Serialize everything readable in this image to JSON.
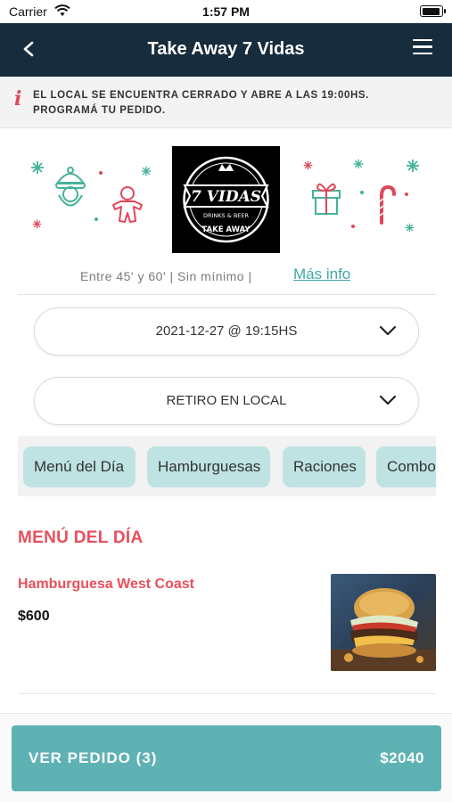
{
  "status_bar": {
    "carrier": "Carrier",
    "time": "1:57 PM"
  },
  "header": {
    "title": "Take Away 7 Vidas",
    "back_icon": "chevron-left-icon",
    "menu_icon": "hamburger-menu-icon"
  },
  "notice": {
    "icon": "info-icon",
    "icon_glyph": "i",
    "text": "EL LOCAL SE ENCUENTRA CERRADO Y ABRE A LAS 19:00HS. PROGRAMÁ TU PEDIDO."
  },
  "logo": {
    "brand": "7 VIDAS",
    "tagline": "DRINKS & BEER",
    "subtitle": "TAKE AWAY"
  },
  "info": {
    "text": "Entre 45' y 60' | Sin mínimo |",
    "link": "Más info"
  },
  "schedule_select": {
    "value": "2021-12-27 @ 19:15HS"
  },
  "delivery_select": {
    "value": "RETIRO EN LOCAL"
  },
  "categories": [
    {
      "label": "Menú del Día"
    },
    {
      "label": "Hamburguesas"
    },
    {
      "label": "Raciones"
    },
    {
      "label": "Combos"
    }
  ],
  "section": {
    "title": "MENÚ DEL DÍA"
  },
  "items": [
    {
      "name": "Hamburguesa West Coast",
      "price": "$600"
    }
  ],
  "order_button": {
    "label": "VER PEDIDO (3)",
    "total": "$2040"
  },
  "colors": {
    "header": "#172c3c",
    "accent": "#e8505b",
    "teal": "#5fb2b4",
    "chip": "#bfe3e3",
    "link": "#3fa7a8"
  }
}
